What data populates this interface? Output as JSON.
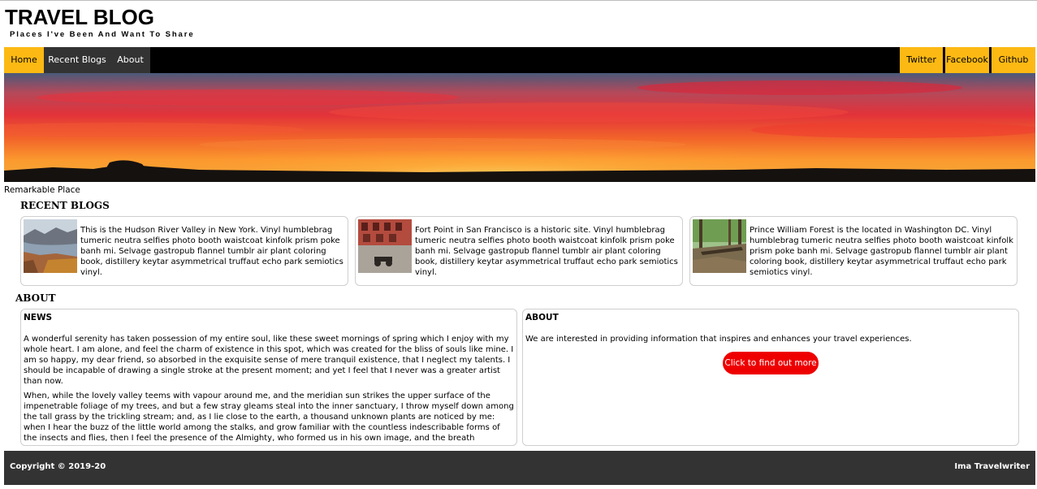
{
  "site": {
    "title": "TRAVEL BLOG",
    "tagline": "Places I've Been And Want To Share"
  },
  "nav": {
    "left": [
      "Home",
      "Recent Blogs",
      "About"
    ],
    "right": [
      "Twitter",
      "Facebook",
      "Github"
    ]
  },
  "hero": {
    "caption": "Remarkable Place"
  },
  "recent": {
    "heading": "RECENT BLOGS",
    "posts": [
      {
        "thumb": "hudson-river-valley-photo",
        "text": "This is the Hudson River Valley in New York. Vinyl humblebrag tumeric neutra selfies photo booth waistcoat kinfolk prism poke banh mi. Selvage gastropub flannel tumblr air plant coloring book, distillery keytar asymmetrical truffaut echo park semiotics vinyl."
      },
      {
        "thumb": "fort-point-photo",
        "text": "Fort Point in San Francisco is a historic site. Vinyl humblebrag tumeric neutra selfies photo booth waistcoat kinfolk prism poke banh mi. Selvage gastropub flannel tumblr air plant coloring book, distillery keytar asymmetrical truffaut echo park semiotics vinyl."
      },
      {
        "thumb": "prince-william-forest-photo",
        "text": "Prince William Forest is the located in Washington DC. Vinyl humblebrag tumeric neutra selfies photo booth waistcoat kinfolk prism poke banh mi. Selvage gastropub flannel tumblr air plant coloring book, distillery keytar asymmetrical truffaut echo park semiotics vinyl."
      }
    ]
  },
  "about": {
    "heading": "ABOUT",
    "news": {
      "title": "NEWS",
      "paragraphs": [
        "A wonderful serenity has taken possession of my entire soul, like these sweet mornings of spring which I enjoy with my whole heart. I am alone, and feel the charm of existence in this spot, which was created for the bliss of souls like mine. I am so happy, my dear friend, so absorbed in the exquisite sense of mere tranquil existence, that I neglect my talents. I should be incapable of drawing a single stroke at the present moment; and yet I feel that I never was a greater artist than now.",
        "When, while the lovely valley teems with vapour around me, and the meridian sun strikes the upper surface of the impenetrable foliage of my trees, and but a few stray gleams steal into the inner sanctuary, I throw myself down among the tall grass by the trickling stream; and, as I lie close to the earth, a thousand unknown plants are noticed by me: when I hear the buzz of the little world among the stalks, and grow familiar with the countless indescribable forms of the insects and flies, then I feel the presence of the Almighty, who formed us in his own image, and the breath"
      ]
    },
    "about_panel": {
      "title": "ABOUT",
      "text": "We are interested in providing information that inspires and enhances your travel experiences.",
      "button": "Click to find out more"
    }
  },
  "footer": {
    "copyright": "Copyright © 2019-20",
    "author": "Ima Travelwriter"
  },
  "colors": {
    "nav_accent": "#fdb913",
    "nav_dark": "#333333",
    "navbar_bg": "#000000",
    "cta": "#ee0000",
    "footer_bg": "#333333"
  }
}
